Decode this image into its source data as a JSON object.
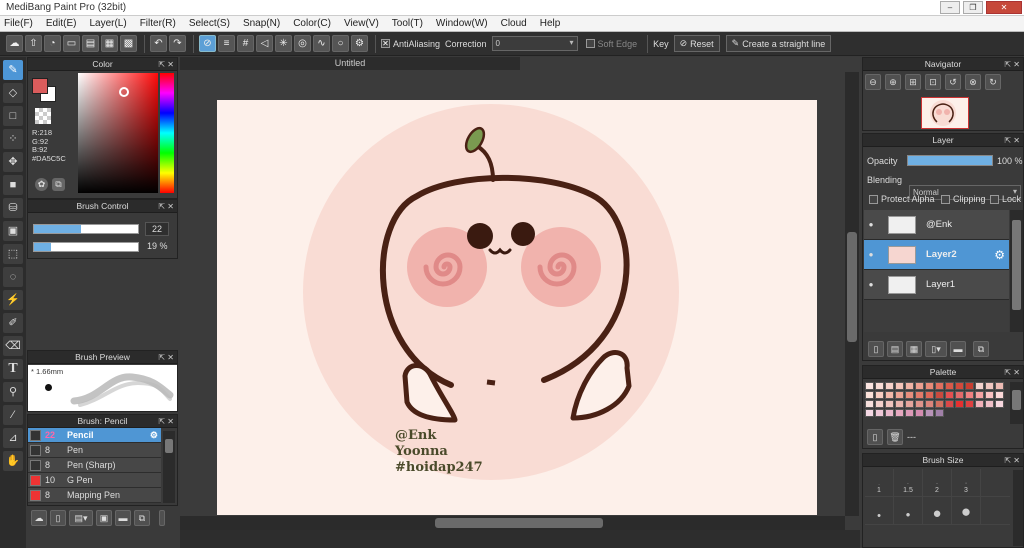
{
  "app": {
    "title": "MediBang Paint Pro (32bit)",
    "window_buttons": [
      "–",
      "❐",
      "✕"
    ]
  },
  "menu": [
    "File(F)",
    "Edit(E)",
    "Layer(L)",
    "Filter(R)",
    "Select(S)",
    "Snap(N)",
    "Color(C)",
    "View(V)",
    "Tool(T)",
    "Window(W)",
    "Cloud",
    "Help"
  ],
  "toolbar": {
    "antialiasing_label": "AntiAliasing",
    "antialiasing_checked": true,
    "correction_label": "Correction",
    "correction_value": "0",
    "soft_edge_label": "Soft Edge",
    "soft_edge_checked": false,
    "key_label": "Key",
    "reset_label": "Reset",
    "straight_line_label": "Create a straight line"
  },
  "color_panel": {
    "title": "Color",
    "r": "R:218",
    "g": "G:92",
    "b": "B:92",
    "hex": "#DA5C5C",
    "primary_color": "#DA5C5C",
    "secondary_color": "#FFFFFF"
  },
  "brush_control": {
    "title": "Brush Control",
    "size_value": "22",
    "opacity_value": "19 %",
    "size_fraction": 0.45,
    "opacity_fraction": 0.16
  },
  "brush_preview": {
    "title": "Brush Preview",
    "size_label": "1.66mm"
  },
  "brush_list": {
    "title": "Brush: Pencil",
    "items": [
      {
        "size": "22",
        "name": "Pencil",
        "color": "#333333",
        "selected": true
      },
      {
        "size": "8",
        "name": "Pen",
        "color": "#333333",
        "selected": false
      },
      {
        "size": "8",
        "name": "Pen (Sharp)",
        "color": "#333333",
        "selected": false
      },
      {
        "size": "10",
        "name": "G Pen",
        "color": "#e33333",
        "selected": false
      },
      {
        "size": "8",
        "name": "Mapping Pen",
        "color": "#e33333",
        "selected": false
      }
    ]
  },
  "canvas": {
    "tab_title": "Untitled",
    "signature_lines": [
      "@Enk",
      "Yoonna",
      "#hoidap247"
    ]
  },
  "navigator": {
    "title": "Navigator"
  },
  "layer_panel": {
    "title": "Layer",
    "opacity_label": "Opacity",
    "opacity_value": "100 %",
    "blending_label": "Blending",
    "blending_value": "Normal",
    "protect_alpha_label": "Protect Alpha",
    "clipping_label": "Clipping",
    "lock_label": "Lock",
    "layers": [
      {
        "name": "@Enk",
        "selected": false
      },
      {
        "name": "Layer2",
        "selected": true
      },
      {
        "name": "Layer1",
        "selected": false
      }
    ]
  },
  "palette": {
    "title": "Palette",
    "footer_text": "---",
    "colors": [
      "#fbe5e1",
      "#f8dcd6",
      "#f6d1c9",
      "#f4c4b9",
      "#f0b3a5",
      "#ec9f90",
      "#e78a78",
      "#e06f5f",
      "#d95a4a",
      "#d14a3c",
      "#c83e31",
      "#f3d2cd",
      "#f0c7c1",
      "#edbbb4",
      "#fbe1d9",
      "#f7cdc1",
      "#f2b8a9",
      "#eda393",
      "#e88e7d",
      "#e37a69",
      "#de6656",
      "#c94a3e",
      "#e55050",
      "#e36a6a",
      "#f08080",
      "#f5a3a3",
      "#fac2c2",
      "#fcd9d9",
      "#f7e0dd",
      "#f2d1cc",
      "#eec4be",
      "#e9b5ae",
      "#e4a59d",
      "#df948b",
      "#db857b",
      "#d1705f",
      "#d84848",
      "#e63030",
      "#e04040",
      "#f2b0b8",
      "#f0c0c8",
      "#f8d8e0",
      "#f4d8e4",
      "#efc8d8",
      "#eab8cc",
      "#e6a8c0",
      "#dd9ab8",
      "#d48cb0",
      "#b893b8",
      "#a080a8"
    ]
  },
  "brush_size": {
    "title": "Brush Size",
    "sizes": [
      "1",
      "1.5",
      "2",
      "3"
    ]
  }
}
